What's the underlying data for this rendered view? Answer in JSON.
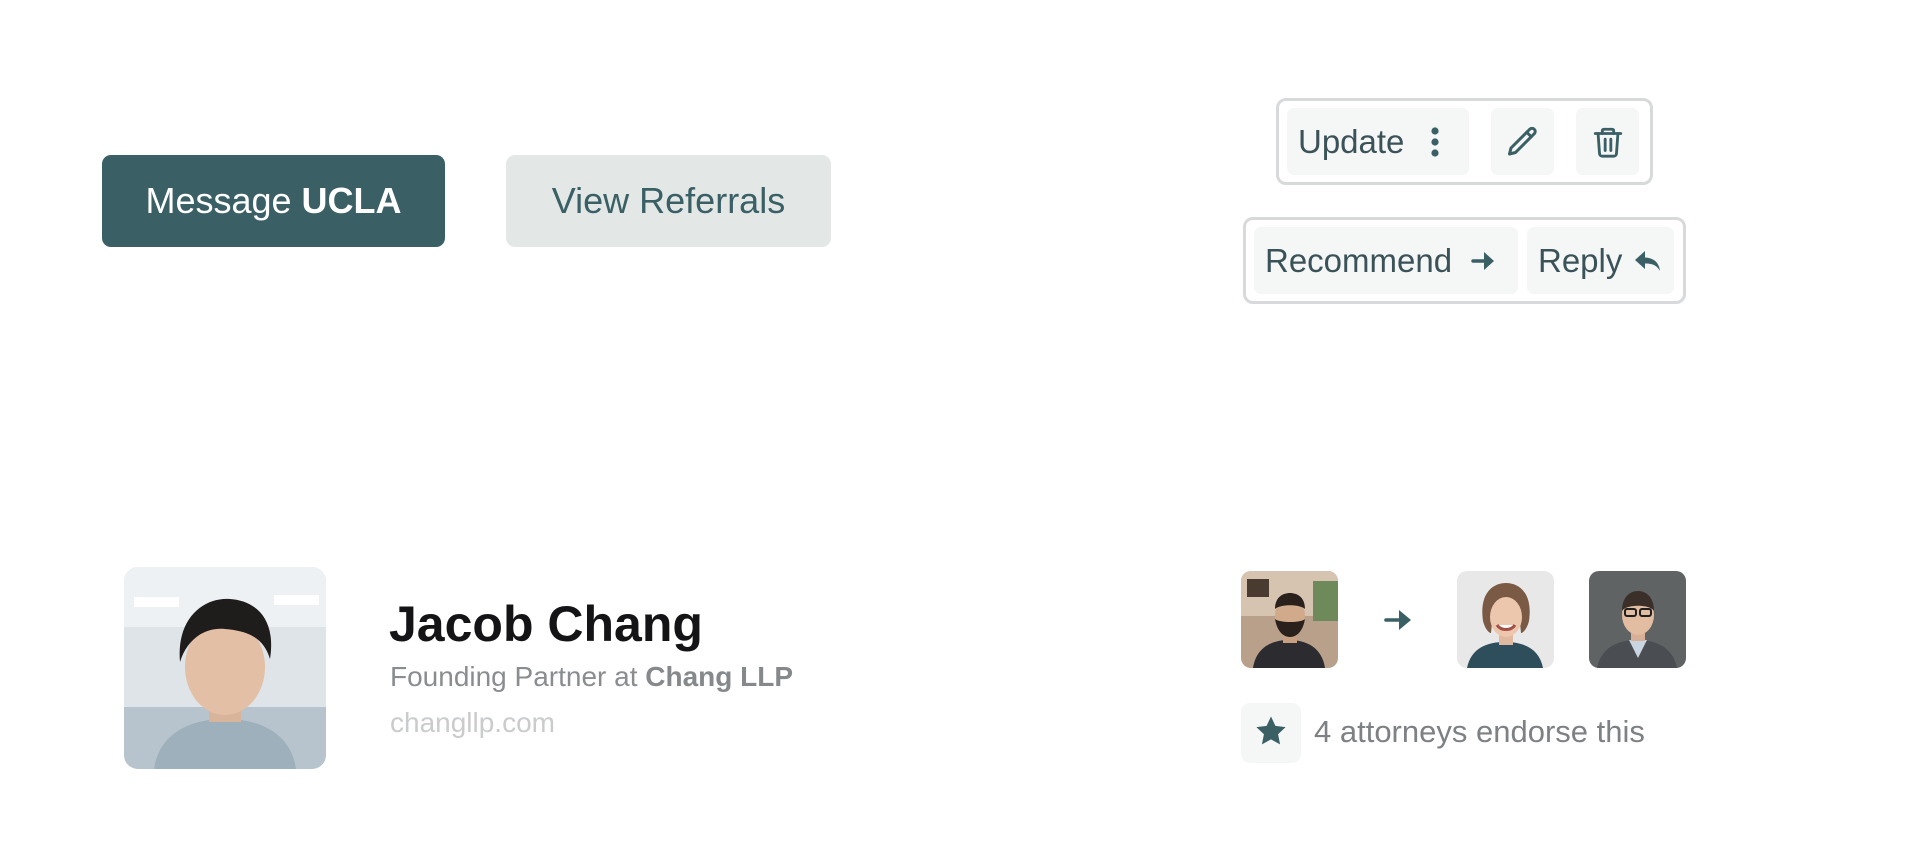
{
  "actions": {
    "primary": {
      "prefix": "Message",
      "strong": "UCLA"
    },
    "secondary": {
      "label": "View Referrals"
    }
  },
  "toolbar_top": {
    "update_label": "Update",
    "icons": [
      "more-vertical-icon",
      "pencil-icon",
      "trash-icon"
    ]
  },
  "toolbar_bottom": {
    "recommend_label": "Recommend",
    "reply_label": "Reply",
    "icons": [
      "arrow-right-icon",
      "reply-arrow-icon"
    ]
  },
  "profile": {
    "name": "Jacob Chang",
    "title_prefix": "Founding Partner at",
    "company": "Chang LLP",
    "website": "changllp.com"
  },
  "endorsement": {
    "text": "4 attorneys endorse this",
    "icon": "star-icon"
  },
  "colors": {
    "brand": "#3a5f65",
    "secondary_bg": "#e3e8e7",
    "chip_bg": "#f5f6f6",
    "border": "#d7d9da",
    "heading": "#141417",
    "muted": "#8a8d90",
    "faint": "#c9cbcd"
  }
}
